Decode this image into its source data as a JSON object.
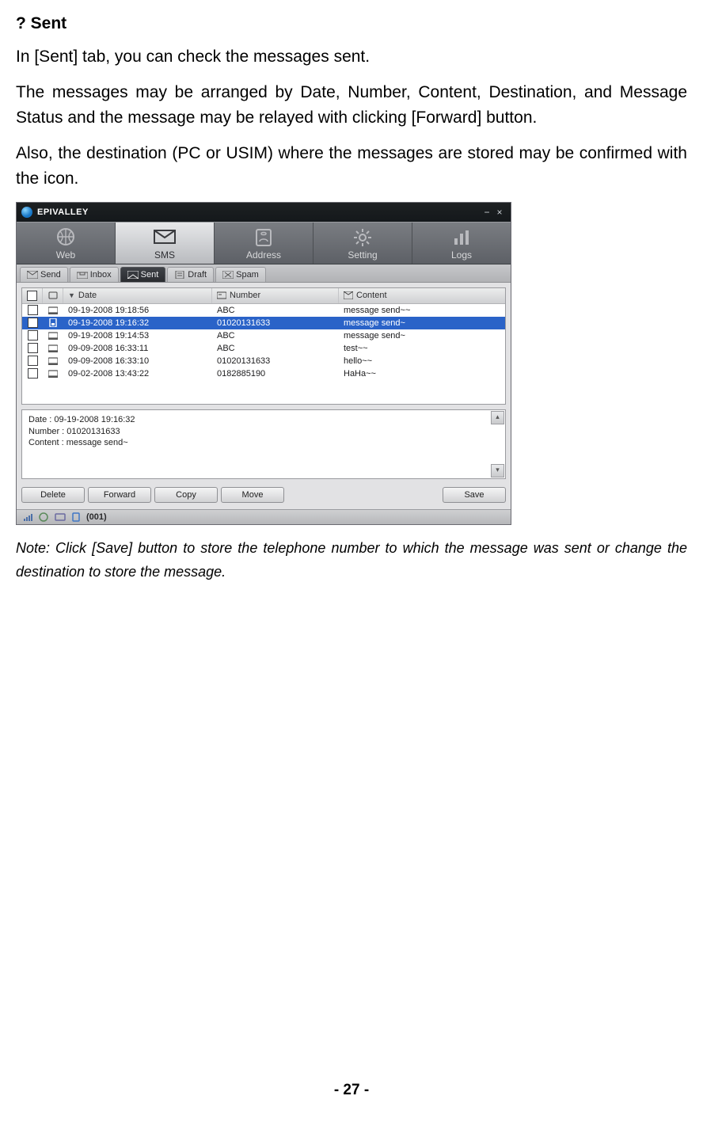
{
  "heading": "? Sent",
  "para1": "In [Sent] tab, you can check the messages sent.",
  "para2": "The messages may be arranged by Date, Number, Content, Destination, and Message Status and the message may be relayed with clicking [Forward] button.",
  "para3": "Also, the destination (PC or USIM) where the messages are stored may be confirmed with the icon.",
  "note": "Note: Click [Save] button to store the telephone number to which the message was sent or change the destination to store the message.",
  "page_num": "- 27 -",
  "app": {
    "title": "EPIVALLEY",
    "nav": {
      "web": "Web",
      "sms": "SMS",
      "address": "Address",
      "setting": "Setting",
      "logs": "Logs"
    },
    "subtabs": {
      "send": "Send",
      "inbox": "Inbox",
      "sent": "Sent",
      "draft": "Draft",
      "spam": "Spam"
    },
    "columns": {
      "date": "Date",
      "number": "Number",
      "content": "Content"
    },
    "rows": [
      {
        "date": "09-19-2008 19:18:56",
        "number": "ABC",
        "content": "message send~~",
        "selected": false,
        "store": "pc"
      },
      {
        "date": "09-19-2008 19:16:32",
        "number": "01020131633",
        "content": "message send~",
        "selected": true,
        "store": "usim"
      },
      {
        "date": "09-19-2008 19:14:53",
        "number": "ABC",
        "content": "message send~",
        "selected": false,
        "store": "pc"
      },
      {
        "date": "09-09-2008 16:33:11",
        "number": "ABC",
        "content": "test~~",
        "selected": false,
        "store": "pc"
      },
      {
        "date": "09-09-2008 16:33:10",
        "number": "01020131633",
        "content": "hello~~",
        "selected": false,
        "store": "pc"
      },
      {
        "date": "09-02-2008 13:43:22",
        "number": "0182885190",
        "content": "HaHa~~",
        "selected": false,
        "store": "pc"
      }
    ],
    "preview": {
      "l1": "Date : 09-19-2008 19:16:32",
      "l2": "Number : 01020131633",
      "l3": "Content : message send~"
    },
    "buttons": {
      "delete": "Delete",
      "forward": "Forward",
      "copy": "Copy",
      "move": "Move",
      "save": "Save"
    },
    "status": {
      "count": "(001)"
    }
  }
}
